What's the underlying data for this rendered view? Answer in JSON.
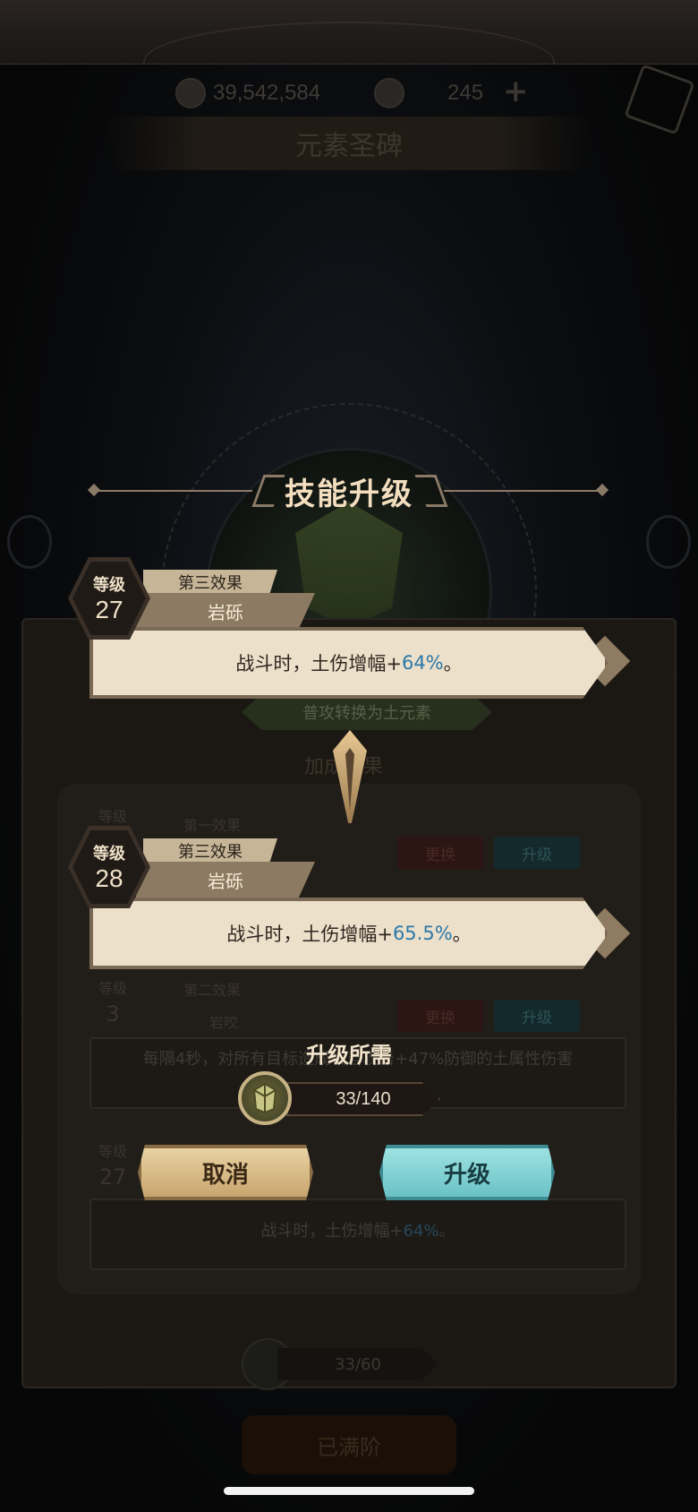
{
  "background": {
    "gold_amount": "39,542,584",
    "gems_amount": "245",
    "plus": "+",
    "screen_title": "元素圣碑",
    "element_banner": "普攻转换为土元素",
    "bonus_header": "加成效果",
    "replace_label": "更换",
    "upgrade_label": "升级",
    "rows": [
      {
        "level_label": "等级",
        "level": "",
        "effect": "第一效果",
        "name": ""
      },
      {
        "level_label": "等级",
        "level": "3",
        "effect": "第二效果",
        "name": "岩咬",
        "desc": "每隔4秒，对所有目标造成相当攻击+47%防御的土属性伤害"
      },
      {
        "level_label": "等级",
        "level": "27",
        "effect": "第三效果",
        "name": "岩砾",
        "desc_prefix": "战斗时，土伤增幅+",
        "desc_value": "64%",
        "desc_suffix": "。"
      }
    ],
    "counter": "33/60",
    "max_button": "已满阶"
  },
  "dialog": {
    "title": "技能升级",
    "current": {
      "level_label": "等级",
      "level": "27",
      "effect": "第三效果",
      "skill_name": "岩砾",
      "desc_prefix": "战斗时，土伤增幅+",
      "desc_value": "64%",
      "desc_suffix": "。"
    },
    "next": {
      "level_label": "等级",
      "level": "28",
      "effect": "第三效果",
      "skill_name": "岩砾",
      "desc_prefix": "战斗时，土伤增幅+",
      "desc_value": "65.5%",
      "desc_suffix": "。"
    },
    "requirement": {
      "title": "升级所需",
      "amount": "33/140",
      "icon": "earth-crystal-icon"
    },
    "cancel_label": "取消",
    "upgrade_label": "升级"
  },
  "colors": {
    "accent_value": "#2c78a8",
    "cancel_button": "#d8bb86",
    "upgrade_button": "#84d2d4",
    "card_bg": "#ece0cb"
  }
}
